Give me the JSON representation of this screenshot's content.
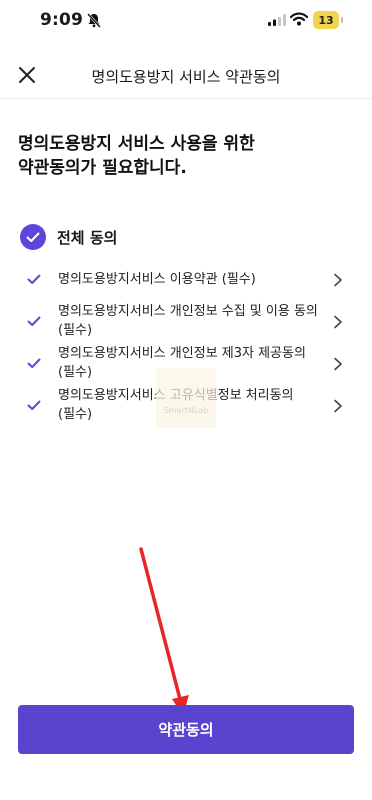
{
  "status_bar": {
    "time": "9:09",
    "battery": "13",
    "battery_color": "#f2d54e"
  },
  "header": {
    "title": "명의도용방지 서비스 약관동의"
  },
  "headline": {
    "line1": "명의도용방지 서비스 사용을 위한",
    "line2": "약관동의가 필요합니다."
  },
  "agree_all": {
    "label": "전체 동의",
    "checked": true
  },
  "terms": [
    {
      "line1": "명의도용방지서비스 이용약관 (필수)",
      "line2": ""
    },
    {
      "line1": "명의도용방지서비스 개인정보 수집 및 이용 동의",
      "line2": "(필수)"
    },
    {
      "line1": "명의도용방지서비스 개인정보 제3자 제공동의",
      "line2": "(필수)"
    },
    {
      "line1": "명의도용방지서비스 고유식별정보 처리동의",
      "line2": "(필수)"
    }
  ],
  "watermark": {
    "text": "SmartNLab"
  },
  "confirm_button": {
    "label": "약관동의"
  },
  "colors": {
    "accent": "#5a43cf",
    "check": "#5f46d6",
    "arrow": "#e5262a"
  }
}
